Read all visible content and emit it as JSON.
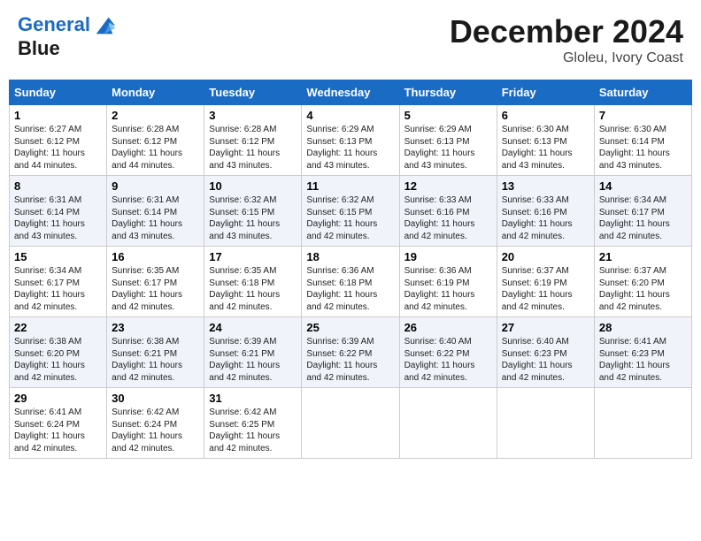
{
  "header": {
    "logo_line1": "General",
    "logo_line2": "Blue",
    "month": "December 2024",
    "location": "Gloleu, Ivory Coast"
  },
  "days_of_week": [
    "Sunday",
    "Monday",
    "Tuesday",
    "Wednesday",
    "Thursday",
    "Friday",
    "Saturday"
  ],
  "weeks": [
    [
      {
        "day": "1",
        "sunrise": "6:27 AM",
        "sunset": "6:12 PM",
        "daylight": "11 hours and 44 minutes."
      },
      {
        "day": "2",
        "sunrise": "6:28 AM",
        "sunset": "6:12 PM",
        "daylight": "11 hours and 44 minutes."
      },
      {
        "day": "3",
        "sunrise": "6:28 AM",
        "sunset": "6:12 PM",
        "daylight": "11 hours and 43 minutes."
      },
      {
        "day": "4",
        "sunrise": "6:29 AM",
        "sunset": "6:13 PM",
        "daylight": "11 hours and 43 minutes."
      },
      {
        "day": "5",
        "sunrise": "6:29 AM",
        "sunset": "6:13 PM",
        "daylight": "11 hours and 43 minutes."
      },
      {
        "day": "6",
        "sunrise": "6:30 AM",
        "sunset": "6:13 PM",
        "daylight": "11 hours and 43 minutes."
      },
      {
        "day": "7",
        "sunrise": "6:30 AM",
        "sunset": "6:14 PM",
        "daylight": "11 hours and 43 minutes."
      }
    ],
    [
      {
        "day": "8",
        "sunrise": "6:31 AM",
        "sunset": "6:14 PM",
        "daylight": "11 hours and 43 minutes."
      },
      {
        "day": "9",
        "sunrise": "6:31 AM",
        "sunset": "6:14 PM",
        "daylight": "11 hours and 43 minutes."
      },
      {
        "day": "10",
        "sunrise": "6:32 AM",
        "sunset": "6:15 PM",
        "daylight": "11 hours and 43 minutes."
      },
      {
        "day": "11",
        "sunrise": "6:32 AM",
        "sunset": "6:15 PM",
        "daylight": "11 hours and 42 minutes."
      },
      {
        "day": "12",
        "sunrise": "6:33 AM",
        "sunset": "6:16 PM",
        "daylight": "11 hours and 42 minutes."
      },
      {
        "day": "13",
        "sunrise": "6:33 AM",
        "sunset": "6:16 PM",
        "daylight": "11 hours and 42 minutes."
      },
      {
        "day": "14",
        "sunrise": "6:34 AM",
        "sunset": "6:17 PM",
        "daylight": "11 hours and 42 minutes."
      }
    ],
    [
      {
        "day": "15",
        "sunrise": "6:34 AM",
        "sunset": "6:17 PM",
        "daylight": "11 hours and 42 minutes."
      },
      {
        "day": "16",
        "sunrise": "6:35 AM",
        "sunset": "6:17 PM",
        "daylight": "11 hours and 42 minutes."
      },
      {
        "day": "17",
        "sunrise": "6:35 AM",
        "sunset": "6:18 PM",
        "daylight": "11 hours and 42 minutes."
      },
      {
        "day": "18",
        "sunrise": "6:36 AM",
        "sunset": "6:18 PM",
        "daylight": "11 hours and 42 minutes."
      },
      {
        "day": "19",
        "sunrise": "6:36 AM",
        "sunset": "6:19 PM",
        "daylight": "11 hours and 42 minutes."
      },
      {
        "day": "20",
        "sunrise": "6:37 AM",
        "sunset": "6:19 PM",
        "daylight": "11 hours and 42 minutes."
      },
      {
        "day": "21",
        "sunrise": "6:37 AM",
        "sunset": "6:20 PM",
        "daylight": "11 hours and 42 minutes."
      }
    ],
    [
      {
        "day": "22",
        "sunrise": "6:38 AM",
        "sunset": "6:20 PM",
        "daylight": "11 hours and 42 minutes."
      },
      {
        "day": "23",
        "sunrise": "6:38 AM",
        "sunset": "6:21 PM",
        "daylight": "11 hours and 42 minutes."
      },
      {
        "day": "24",
        "sunrise": "6:39 AM",
        "sunset": "6:21 PM",
        "daylight": "11 hours and 42 minutes."
      },
      {
        "day": "25",
        "sunrise": "6:39 AM",
        "sunset": "6:22 PM",
        "daylight": "11 hours and 42 minutes."
      },
      {
        "day": "26",
        "sunrise": "6:40 AM",
        "sunset": "6:22 PM",
        "daylight": "11 hours and 42 minutes."
      },
      {
        "day": "27",
        "sunrise": "6:40 AM",
        "sunset": "6:23 PM",
        "daylight": "11 hours and 42 minutes."
      },
      {
        "day": "28",
        "sunrise": "6:41 AM",
        "sunset": "6:23 PM",
        "daylight": "11 hours and 42 minutes."
      }
    ],
    [
      {
        "day": "29",
        "sunrise": "6:41 AM",
        "sunset": "6:24 PM",
        "daylight": "11 hours and 42 minutes."
      },
      {
        "day": "30",
        "sunrise": "6:42 AM",
        "sunset": "6:24 PM",
        "daylight": "11 hours and 42 minutes."
      },
      {
        "day": "31",
        "sunrise": "6:42 AM",
        "sunset": "6:25 PM",
        "daylight": "11 hours and 42 minutes."
      },
      null,
      null,
      null,
      null
    ]
  ],
  "labels": {
    "sunrise": "Sunrise:",
    "sunset": "Sunset:",
    "daylight": "Daylight:"
  }
}
